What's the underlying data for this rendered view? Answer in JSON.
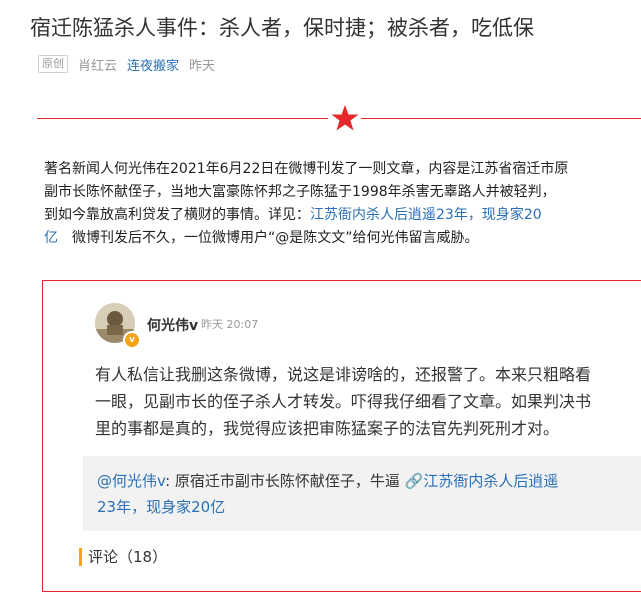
{
  "article": {
    "title": "宿迁陈猛杀人事件：杀人者，保时捷；被杀者，吃低保",
    "badge": "原创",
    "author": "肖红云",
    "source": "连夜搬家",
    "time": "昨天"
  },
  "body": {
    "line1": "著名新闻人何光伟在2021年6月22日在微博刊发了一则文章，内容是江苏省宿迁市原",
    "line2": "副市长陈怀献侄子，当地大富豪陈怀邦之子陈猛于1998年杀害无辜路人并被轻判，",
    "line3_text": "到如今靠放高利贷发了横财的事情。详见：",
    "line3_link": "江苏衙内杀人后逍遥23年，现身家20",
    "line4_link": "亿",
    "line4_text": "　微博刊发后不久，一位微博用户“@是陈文文”给何光伟留言威胁。"
  },
  "weibo": {
    "username": "何光伟v",
    "verified_mark": "v",
    "time": "昨天 20:07",
    "post_lines": [
      "有人私信让我删这条微博，说这是诽谤啥的，还报警了。本来只粗略看",
      "一眼，见副市长的侄子杀人才转发。吓得我仔细看了文章。如果判决书",
      "里的事都是真的，我觉得应该把审陈猛案子的法官先判死刑才对。"
    ],
    "repost_at": "@何光伟v",
    "repost_text": ": 原宿迁市副市长陈怀献侄子，牛逼 ",
    "repost_link_1": "🔗江苏衙内杀人后逍遥",
    "repost_link_2": "23年，现身家20亿",
    "comments_label": "评论（18）"
  },
  "colors": {
    "accent_red": "#e7282a",
    "link_blue": "#2a6fb5",
    "badge_orange": "#f7a21b"
  }
}
